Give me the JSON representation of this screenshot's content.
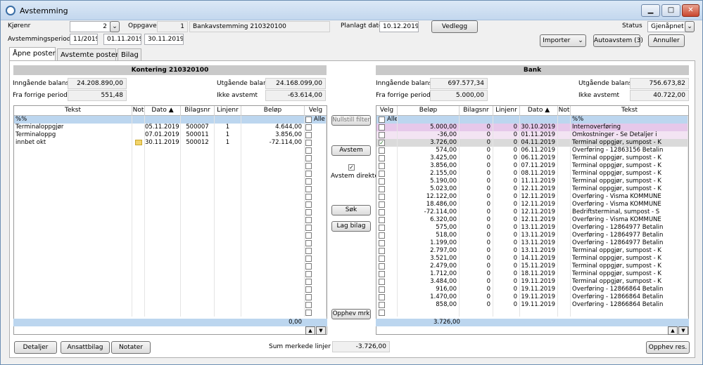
{
  "window": {
    "title": "Avstemming"
  },
  "header": {
    "kjorenr_label": "Kjørenr",
    "kjorenr_value": "2",
    "oppgave_label": "Oppgave",
    "oppgave_nr": "1",
    "oppgave_name": "Bankavstemming 210320100",
    "planlagt_label": "Planlagt dato",
    "planlagt_value": "10.12.2019",
    "vedlegg": "Vedlegg",
    "status_label": "Status",
    "status_value": "Gjenåpnet",
    "periode_label": "Avstemmingsperiode",
    "periode": "11/2019",
    "fra": "01.11.2019",
    "til": "30.11.2019",
    "importer": "Importer",
    "autoavstem": "Autoavstem (3)",
    "annuller": "Annuller"
  },
  "tabs": [
    "Åpne poster",
    "Avstemte poster",
    "Bilag"
  ],
  "left": {
    "title": "Kontering 210320100",
    "inn_label": "Inngående balanse",
    "inn_value": "24.208.890,00",
    "ffp_label": "Fra forrige periode",
    "ffp_value": "551,48",
    "utg_label": "Utgående balanse",
    "utg_value": "24.168.099,00",
    "ikke_label": "Ikke avstemt",
    "ikke_value": "-63.614,00",
    "columns": [
      "Tekst",
      "Not",
      "Dato",
      "Bilagsnr",
      "Linjenr",
      "Beløp",
      "Velg"
    ],
    "filter_text": "%%",
    "alle": "Alle",
    "rows": [
      {
        "tekst": "Terminaloppgjør",
        "not": "",
        "dato": "05.11.2019",
        "bilag": "500007",
        "linje": "1",
        "belop": "4.644,00"
      },
      {
        "tekst": "Terminaloppg",
        "not": "",
        "dato": "07.01.2019",
        "bilag": "500011",
        "linje": "1",
        "belop": "3.856,00"
      },
      {
        "tekst": "innbet okt",
        "not": "note",
        "dato": "30.11.2019",
        "bilag": "500012",
        "linje": "1",
        "belop": "-72.114,00"
      }
    ],
    "sum": "0,00"
  },
  "middle": {
    "nullstill": "Nullstill filter",
    "avstem": "Avstem",
    "avstem_direkte": "Avstem direkte",
    "sok": "Søk",
    "lag_bilag": "Lag bilag",
    "opphev_mrk": "Opphev mrk"
  },
  "right": {
    "title": "Bank",
    "inn_label": "Inngående balanse",
    "inn_value": "697.577,34",
    "ffp_label": "Fra forrige periode",
    "ffp_value": "5.000,00",
    "utg_label": "Utgående balanse",
    "utg_value": "756.673,82",
    "ikke_label": "Ikke avstemt",
    "ikke_value": "40.722,00",
    "columns": [
      "Velg",
      "Beløp",
      "Bilagsnr",
      "Linjenr",
      "Dato",
      "Not",
      "Tekst"
    ],
    "filter_text": "%%",
    "alle": "Alle",
    "rows": [
      {
        "checked": false,
        "belop": "5.000,00",
        "bilag": "0",
        "linje": "0",
        "dato": "30.10.2019",
        "tekst": "Internoverføring",
        "hl": "pink"
      },
      {
        "checked": false,
        "belop": "-36,00",
        "bilag": "0",
        "linje": "0",
        "dato": "01.11.2019",
        "tekst": "Omkostninger - Se Detaljer i",
        "hl": "lpink"
      },
      {
        "checked": true,
        "belop": "3.726,00",
        "bilag": "0",
        "linje": "0",
        "dato": "04.11.2019",
        "tekst": "Terminal oppgjør, sumpost - K",
        "hl": "grey"
      },
      {
        "checked": false,
        "belop": "574,00",
        "bilag": "0",
        "linje": "0",
        "dato": "06.11.2019",
        "tekst": "Overføring - 12863156 Betalin",
        "hl": ""
      },
      {
        "checked": false,
        "belop": "3.425,00",
        "bilag": "0",
        "linje": "0",
        "dato": "06.11.2019",
        "tekst": "Terminal oppgjør, sumpost - K",
        "hl": ""
      },
      {
        "checked": false,
        "belop": "3.856,00",
        "bilag": "0",
        "linje": "0",
        "dato": "07.11.2019",
        "tekst": "Terminal oppgjør, sumpost - K",
        "hl": ""
      },
      {
        "checked": false,
        "belop": "2.155,00",
        "bilag": "0",
        "linje": "0",
        "dato": "08.11.2019",
        "tekst": "Terminal oppgjør, sumpost - K",
        "hl": ""
      },
      {
        "checked": false,
        "belop": "5.190,00",
        "bilag": "0",
        "linje": "0",
        "dato": "11.11.2019",
        "tekst": "Terminal oppgjør, sumpost - K",
        "hl": ""
      },
      {
        "checked": false,
        "belop": "5.023,00",
        "bilag": "0",
        "linje": "0",
        "dato": "12.11.2019",
        "tekst": "Terminal oppgjør, sumpost - K",
        "hl": ""
      },
      {
        "checked": false,
        "belop": "12.122,00",
        "bilag": "0",
        "linje": "0",
        "dato": "12.11.2019",
        "tekst": "Overføring - Visma KOMMUNE",
        "hl": ""
      },
      {
        "checked": false,
        "belop": "18.486,00",
        "bilag": "0",
        "linje": "0",
        "dato": "12.11.2019",
        "tekst": "Overføring - Visma KOMMUNE",
        "hl": ""
      },
      {
        "checked": false,
        "belop": "-72.114,00",
        "bilag": "0",
        "linje": "0",
        "dato": "12.11.2019",
        "tekst": "Bedriftsterminal, sumpost - S",
        "hl": ""
      },
      {
        "checked": false,
        "belop": "6.320,00",
        "bilag": "0",
        "linje": "0",
        "dato": "12.11.2019",
        "tekst": "Overføring - Visma KOMMUNE",
        "hl": ""
      },
      {
        "checked": false,
        "belop": "575,00",
        "bilag": "0",
        "linje": "0",
        "dato": "13.11.2019",
        "tekst": "Overføring - 12864977 Betalin",
        "hl": ""
      },
      {
        "checked": false,
        "belop": "518,00",
        "bilag": "0",
        "linje": "0",
        "dato": "13.11.2019",
        "tekst": "Overføring - 12864977 Betalin",
        "hl": ""
      },
      {
        "checked": false,
        "belop": "1.199,00",
        "bilag": "0",
        "linje": "0",
        "dato": "13.11.2019",
        "tekst": "Overføring - 12864977 Betalin",
        "hl": ""
      },
      {
        "checked": false,
        "belop": "2.797,00",
        "bilag": "0",
        "linje": "0",
        "dato": "13.11.2019",
        "tekst": "Terminal oppgjør, sumpost - K",
        "hl": ""
      },
      {
        "checked": false,
        "belop": "3.521,00",
        "bilag": "0",
        "linje": "0",
        "dato": "14.11.2019",
        "tekst": "Terminal oppgjør, sumpost - K",
        "hl": ""
      },
      {
        "checked": false,
        "belop": "2.479,00",
        "bilag": "0",
        "linje": "0",
        "dato": "15.11.2019",
        "tekst": "Terminal oppgjør, sumpost - K",
        "hl": ""
      },
      {
        "checked": false,
        "belop": "1.712,00",
        "bilag": "0",
        "linje": "0",
        "dato": "18.11.2019",
        "tekst": "Terminal oppgjør, sumpost - K",
        "hl": ""
      },
      {
        "checked": false,
        "belop": "3.484,00",
        "bilag": "0",
        "linje": "0",
        "dato": "19.11.2019",
        "tekst": "Terminal oppgjør, sumpost - K",
        "hl": ""
      },
      {
        "checked": false,
        "belop": "916,00",
        "bilag": "0",
        "linje": "0",
        "dato": "19.11.2019",
        "tekst": "Overføring - 12866864 Betalin",
        "hl": ""
      },
      {
        "checked": false,
        "belop": "1.470,00",
        "bilag": "0",
        "linje": "0",
        "dato": "19.11.2019",
        "tekst": "Overføring - 12866864 Betalin",
        "hl": ""
      },
      {
        "checked": false,
        "belop": "858,00",
        "bilag": "0",
        "linje": "0",
        "dato": "19.11.2019",
        "tekst": "Overføring - 12866864 Betalin",
        "hl": ""
      }
    ],
    "sum": "3.726,00"
  },
  "footer": {
    "detaljer": "Detaljer",
    "ansattbilag": "Ansattbilag",
    "notater": "Notater",
    "sum_label": "Sum merkede linjer",
    "sum_value": "-3.726,00",
    "opphev_res": "Opphev res."
  },
  "colors": {
    "pink": "#e6c8ea",
    "lpink": "#f3e4f3",
    "grey": "#dadada",
    "filter_row": "#bcd6ef",
    "sum_bar": "#bcd6ef",
    "header_band": "#c9c9c9"
  }
}
